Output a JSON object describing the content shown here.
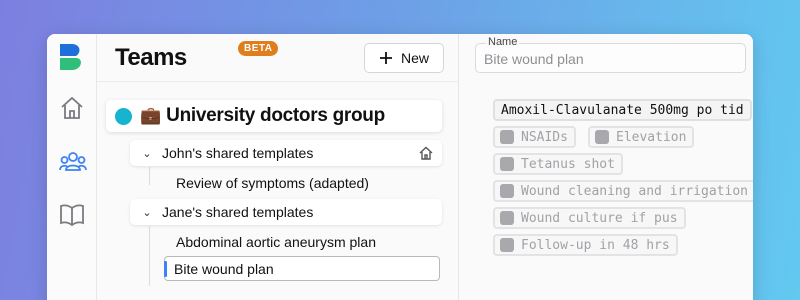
{
  "teams": {
    "title": "Teams",
    "badge": "BETA",
    "new_button": "New"
  },
  "group": {
    "emoji": "💼",
    "name": "University doctors group"
  },
  "tree": {
    "johns_header": "John's shared templates",
    "johns_item": "Review of symptoms (adapted)",
    "janes_header": "Jane's shared templates",
    "janes_item_1": "Abdominal aortic aneurysm plan",
    "janes_item_2": "Bite wound plan"
  },
  "plan": {
    "name_label": "Name",
    "name_value": "Bite wound plan",
    "orders": [
      "Amoxil-Clavulanate 500mg po tid",
      "NSAIDs",
      "Elevation",
      "Tetanus shot",
      "Wound cleaning and irrigation",
      "Wound culture if pus",
      "Follow-up in 48 hrs"
    ]
  },
  "colors": {
    "brand_blue": "#1e6fd9",
    "brand_green": "#2fbf7a",
    "badge_orange": "#e07e1c",
    "group_dot": "#17b4cf",
    "selection_accent": "#3d84f2"
  },
  "icons": {
    "logo": "app-logo-icon",
    "home": "home-icon",
    "teams": "people-icon",
    "library": "book-icon",
    "plus": "plus-icon"
  }
}
